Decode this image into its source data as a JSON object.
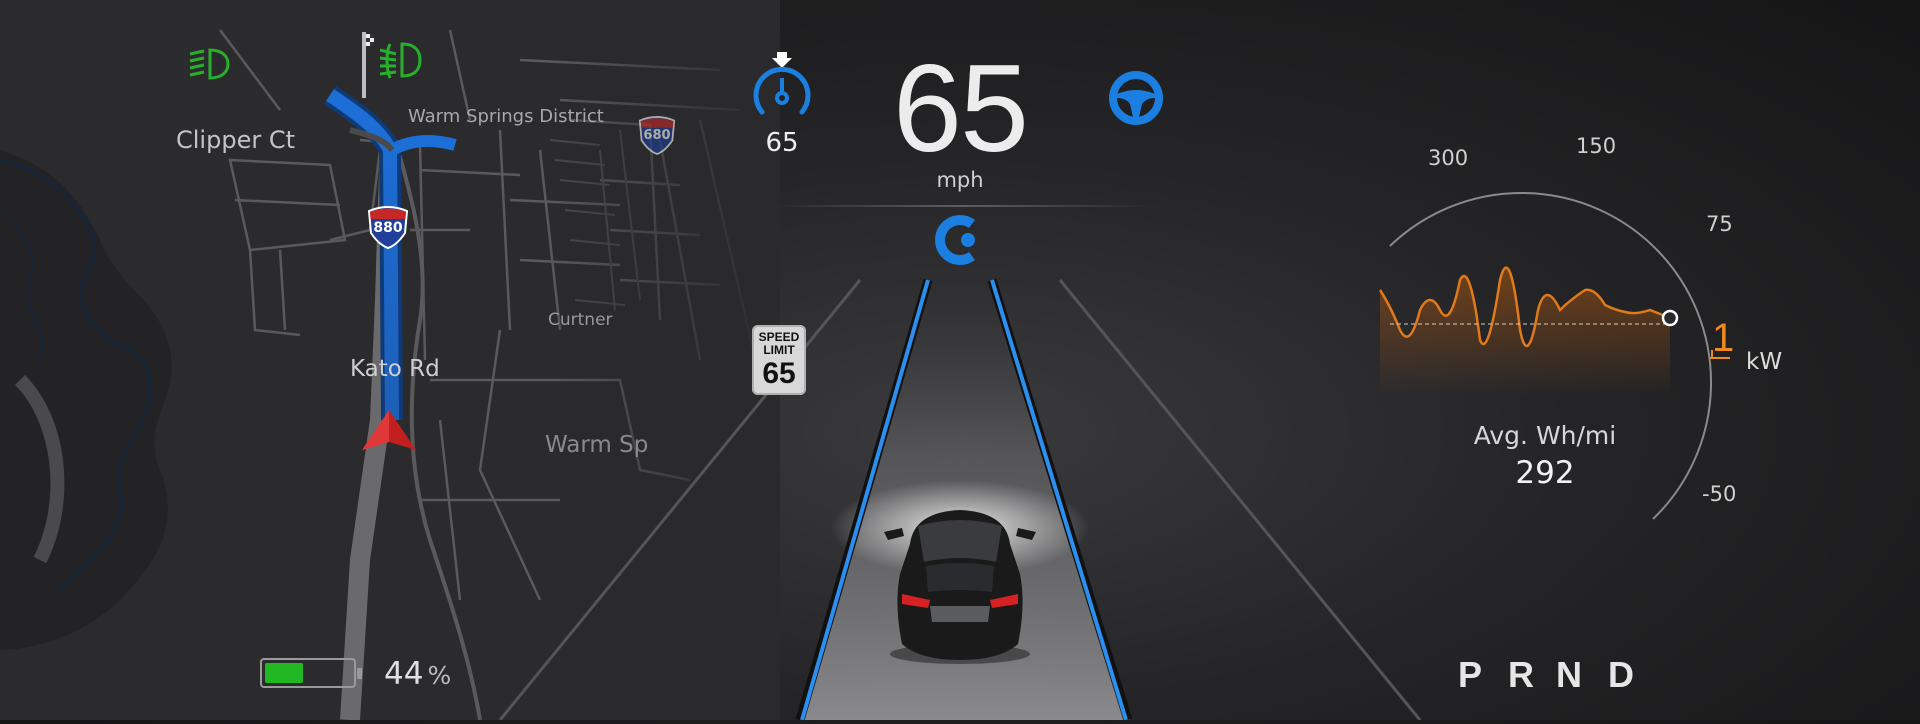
{
  "map": {
    "labels": {
      "clipper": "Clipper Ct",
      "warm_springs_district": "Warm Springs District",
      "curtner": "Curtner",
      "kato": "Kato Rd",
      "warm_springs_2": "Warm Sp"
    },
    "shields": {
      "i880": "880",
      "i680": "680"
    }
  },
  "telltales": {
    "headlight_icon": "headlight-icon",
    "fog_light_icon": "fog-light-icon",
    "checkered_flag_icon": "checkered-flag-icon"
  },
  "speed": {
    "value": "65",
    "unit": "mph"
  },
  "cruise": {
    "set_speed": "65",
    "icon": "cruise-speed-icon",
    "color": "#1a7fe0"
  },
  "autosteer": {
    "icon": "steering-wheel-icon",
    "color": "#1a7fe0"
  },
  "autopilot": {
    "icon": "autopilot-icon"
  },
  "speed_limit": {
    "line1": "SPEED",
    "line2": "LIMIT",
    "value": "65"
  },
  "battery": {
    "percent": "44",
    "unit": "%",
    "level": 0.44,
    "color": "#22b824"
  },
  "power_gauge": {
    "tick_labels": {
      "t300": "300",
      "t150": "150",
      "t75": "75",
      "tm50": "-50"
    },
    "current_kw": "1",
    "kw_unit": "kW",
    "avg_label": "Avg. Wh/mi",
    "avg_value": "292",
    "accent": "#f08a1c"
  },
  "gears": {
    "p": "P",
    "r": "R",
    "n": "N",
    "d": "D"
  }
}
